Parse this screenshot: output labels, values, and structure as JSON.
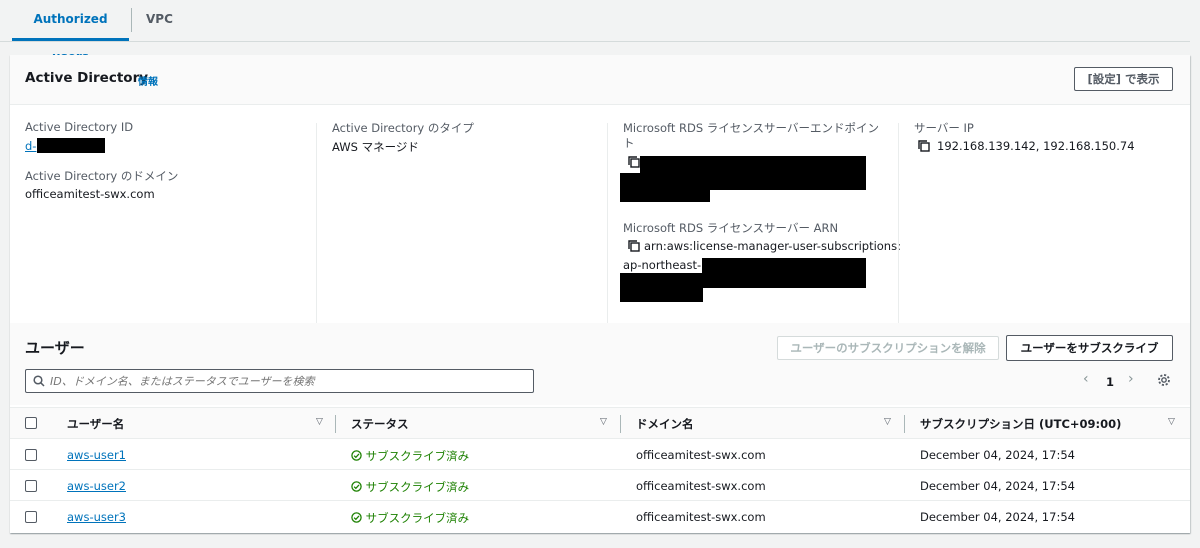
{
  "tabs": [
    {
      "label": "Authorized users"
    },
    {
      "label": "VPC"
    }
  ],
  "ad_panel": {
    "title": "Active Directory",
    "info_link": "情報",
    "settings_button": "[設定] で表示",
    "ad_id_label": "Active Directory ID",
    "ad_id_value": "d-",
    "ad_domain_label": "Active Directory のドメイン",
    "ad_domain_value": "officeamitest-swx.com",
    "ad_type_label": "Active Directory のタイプ",
    "ad_type_value": "AWS マネージド",
    "rds_endpoint_label": "Microsoft RDS ライセンスサーバーエンドポイン",
    "rds_endpoint_label_cont": "ト",
    "rds_arn_label": "Microsoft RDS ライセンスサーバー ARN",
    "rds_arn_value_line1": "arn:aws:license-manager-user-subscriptions:",
    "rds_arn_value_line2": "ap-northeast-1:",
    "server_ip_label": "サーバー IP",
    "server_ip_value": "192.168.139.142, 192.168.150.74"
  },
  "users": {
    "title": "ユーザー",
    "unsubscribe_button": "ユーザーのサブスクリプションを解除",
    "subscribe_button": "ユーザーをサブスクライブ",
    "search_placeholder": "ID、ドメイン名、またはステータスでユーザーを検索",
    "page_number": "1",
    "columns": [
      "ユーザー名",
      "ステータス",
      "ドメイン名",
      "サブスクリプション日 (UTC+09:00)"
    ],
    "rows": [
      {
        "username": "aws-user1",
        "status": "サブスクライブ済み",
        "domain": "officeamitest-swx.com",
        "date": "December 04, 2024, 17:54"
      },
      {
        "username": "aws-user2",
        "status": "サブスクライブ済み",
        "domain": "officeamitest-swx.com",
        "date": "December 04, 2024, 17:54"
      },
      {
        "username": "aws-user3",
        "status": "サブスクライブ済み",
        "domain": "officeamitest-swx.com",
        "date": "December 04, 2024, 17:54"
      }
    ]
  },
  "colors": {
    "link": "#0073bb",
    "success": "#1d8102",
    "border": "#545b64"
  }
}
